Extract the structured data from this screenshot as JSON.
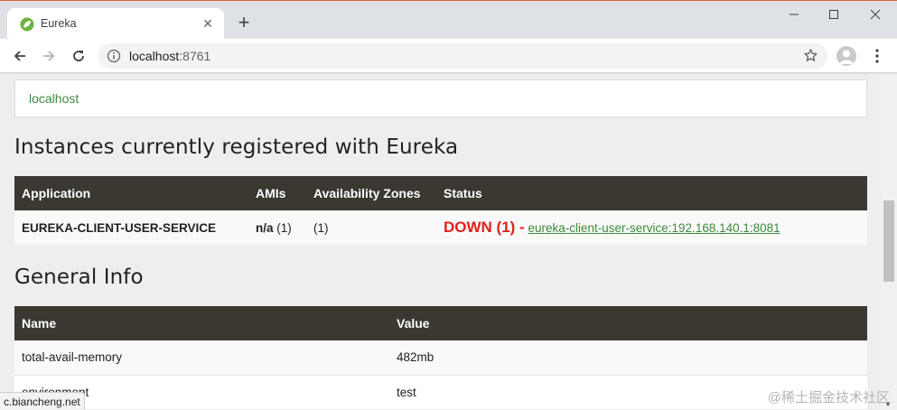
{
  "browser": {
    "tab": {
      "title": "Eureka",
      "close": "✕"
    },
    "new_tab": "+",
    "window_controls": {
      "minimize": "—",
      "maximize": "☐",
      "close": "✕"
    },
    "address": {
      "host": "localhost",
      "port": ":8761"
    }
  },
  "page": {
    "host_panel": "localhost",
    "instances": {
      "heading": "Instances currently registered with Eureka",
      "columns": [
        "Application",
        "AMIs",
        "Availability Zones",
        "Status"
      ],
      "rows": [
        {
          "application": "EUREKA-CLIENT-USER-SERVICE",
          "amis_bold": "n/a",
          "amis_count": "(1)",
          "zones": "(1)",
          "status": "DOWN (1) -",
          "instance_link": "eureka-client-user-service:192.168.140.1:8081"
        }
      ]
    },
    "general": {
      "heading": "General Info",
      "columns": [
        "Name",
        "Value"
      ],
      "rows": [
        {
          "name": "total-avail-memory",
          "value": "482mb"
        },
        {
          "name": "environment",
          "value": "test"
        }
      ]
    }
  },
  "status_bar": "c.biancheng.net",
  "watermark": "@稀土掘金技术社区",
  "colors": {
    "accent_green": "#3d8b3d",
    "status_down": "#e11e1e",
    "table_header": "#3a3831"
  }
}
